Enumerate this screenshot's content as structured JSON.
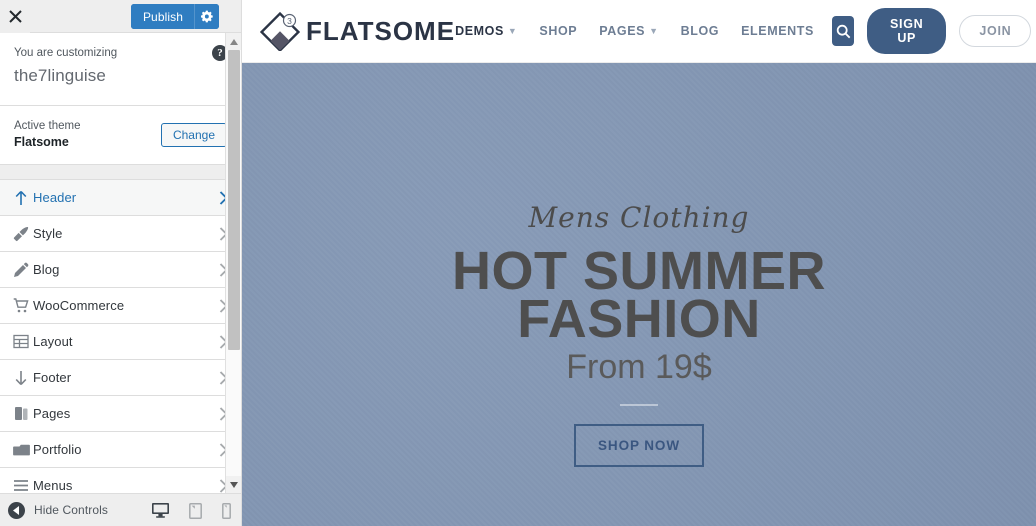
{
  "customizer": {
    "close_icon": "close-icon",
    "publish_label": "Publish",
    "gear_icon": "gear-icon",
    "customizing_label": "You are customizing",
    "site_title": "the7linguise",
    "help_icon": "help-icon",
    "help_glyph": "?",
    "active_theme_label": "Active theme",
    "active_theme_name": "Flatsome",
    "change_label": "Change",
    "hide_controls_label": "Hide Controls",
    "accent_color": "#2271b1",
    "panel_items": [
      {
        "label": "Header",
        "icon": "arrow-up-icon",
        "active": true
      },
      {
        "label": "Style",
        "icon": "paintbrush-icon",
        "active": false
      },
      {
        "label": "Blog",
        "icon": "pencil-icon",
        "active": false
      },
      {
        "label": "WooCommerce",
        "icon": "cart-icon",
        "active": false
      },
      {
        "label": "Layout",
        "icon": "grid-icon",
        "active": false
      },
      {
        "label": "Footer",
        "icon": "arrow-down-icon",
        "active": false
      },
      {
        "label": "Pages",
        "icon": "pages-icon",
        "active": false
      },
      {
        "label": "Portfolio",
        "icon": "folder-icon",
        "active": false
      },
      {
        "label": "Menus",
        "icon": "menu-lines-icon",
        "active": false
      }
    ],
    "devices": [
      {
        "name": "desktop-preview-icon",
        "selected": true
      },
      {
        "name": "tablet-preview-icon",
        "selected": false
      },
      {
        "name": "mobile-preview-icon",
        "selected": false
      }
    ]
  },
  "site": {
    "brand_name": "FLATSOME",
    "brand_logo_icon": "flatsome-diamond-logo",
    "brand_logo_badge": "3",
    "nav": [
      {
        "label": "DEMOS",
        "has_caret": true,
        "current": true
      },
      {
        "label": "SHOP",
        "has_caret": false,
        "current": false
      },
      {
        "label": "PAGES",
        "has_caret": true,
        "current": false
      },
      {
        "label": "BLOG",
        "has_caret": false,
        "current": false
      },
      {
        "label": "ELEMENTS",
        "has_caret": false,
        "current": false
      }
    ],
    "search_icon": "search-icon",
    "signup_label": "SIGN UP",
    "join_label": "JOIN",
    "header_accent": "#3f5d84",
    "hero": {
      "background_color": "#8296b4",
      "eyebrow": "Mens Clothing",
      "title_line1": "HOT SUMMER",
      "title_line2": "FASHION",
      "subtitle": "From 19$",
      "cta_label": "SHOP NOW"
    }
  }
}
